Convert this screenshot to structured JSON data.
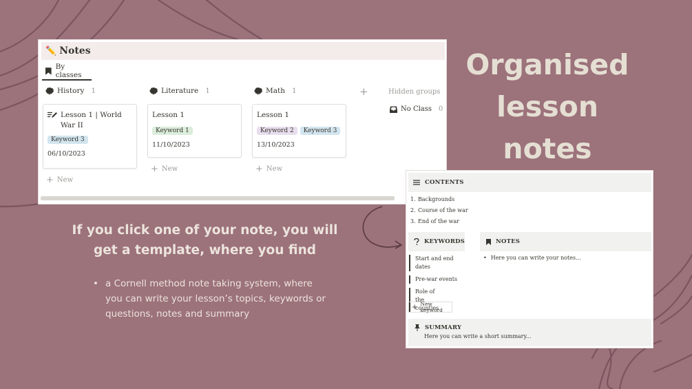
{
  "headline": [
    "Organised",
    "lesson",
    "notes"
  ],
  "subhead": [
    "If you click one of your note, you will",
    "get a template, where you find"
  ],
  "bullets": [
    "a Cornell method note taking system, where you can write your lesson’s topics, keywords or questions, notes and summary"
  ],
  "board": {
    "title": "Notes",
    "view_tab": "By classes",
    "add_group": "+",
    "hidden_groups": "Hidden groups",
    "no_class": {
      "label": "No Class",
      "count": "0"
    },
    "new_label": "New",
    "columns": [
      {
        "name": "History",
        "count": "1",
        "card": {
          "title": "Lesson 1 | World War II",
          "tags": [
            "Keyword 3"
          ],
          "date": "06/10/2023"
        }
      },
      {
        "name": "Literature",
        "count": "1",
        "card": {
          "title": "Lesson 1",
          "tags": [
            "Keyword 1"
          ],
          "date": "11/10/2023"
        }
      },
      {
        "name": "Math",
        "count": "1",
        "card": {
          "title": "Lesson 1",
          "tags": [
            "Keyword 2",
            "Keyword 3"
          ],
          "date": "13/10/2023"
        }
      }
    ]
  },
  "template": {
    "contents_label": "CONTENTS",
    "contents": [
      {
        "n": "1.",
        "text": "Backgrounds"
      },
      {
        "n": "2.",
        "text": "Course of the war"
      },
      {
        "n": "3.",
        "text": "End of the war"
      }
    ],
    "keywords_label": "KEYWORDS",
    "keywords": [
      "Start and end dates",
      "Pre-war events",
      "Role of the counties"
    ],
    "new_keyword": "New keyword",
    "notes_label": "NOTES",
    "notes_item": "Here you can write your notes...",
    "summary_label": "SUMMARY",
    "summary_text": "Here you can write a short summary..."
  },
  "colors": {
    "background": "#9c727b",
    "headline": "#e5dfd3",
    "tag_blue": "#d3e5ef",
    "tag_green": "#dbeddb",
    "tag_purple": "#e8deee"
  }
}
